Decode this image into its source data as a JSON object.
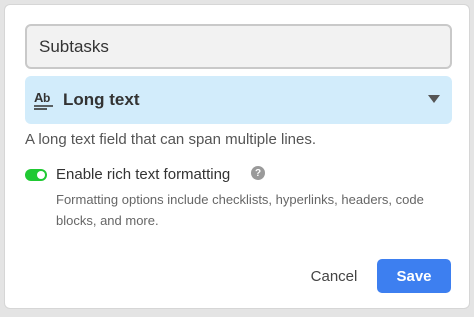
{
  "field": {
    "name_value": "Subtasks",
    "type_label": "Long text",
    "type_icon": "text-ab-icon",
    "description": "A long text field that can span multiple lines."
  },
  "rich_text": {
    "label": "Enable rich text formatting",
    "enabled": true,
    "help_icon_glyph": "?",
    "help_text": "Formatting options include checklists, hyperlinks, headers, code blocks, and more."
  },
  "actions": {
    "cancel_label": "Cancel",
    "save_label": "Save"
  },
  "colors": {
    "accent": "#3d7ff0",
    "toggle_on": "#20c933",
    "select_bg": "#d2ecfb"
  }
}
